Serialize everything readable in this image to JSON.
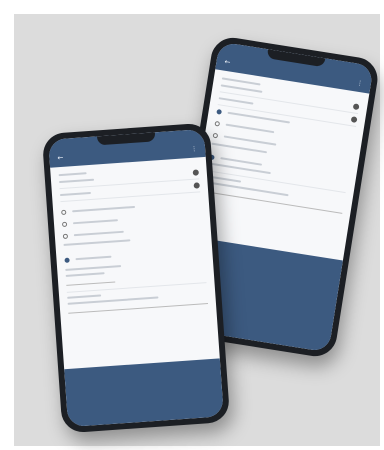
{
  "image": {
    "description_labels": [],
    "phones": [
      {
        "name": "back-phone",
        "appbar_title": ""
      },
      {
        "name": "front-phone",
        "appbar_title": ""
      }
    ]
  }
}
